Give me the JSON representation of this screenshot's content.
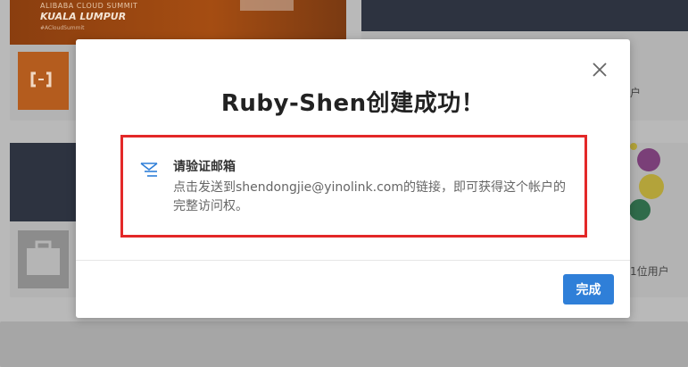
{
  "background": {
    "banner": {
      "line1": "ALIBABA CLOUD SUMMIT",
      "line2": "KUALA LUMPUR",
      "line3": "#ACloudSummit"
    },
    "right_text_top": "户",
    "right_text_bottom": "1位用户"
  },
  "dialog": {
    "title": "Ruby-Shen创建成功！",
    "close_icon": "close-icon",
    "notice": {
      "icon": "mail-send-icon",
      "heading": "请验证邮箱",
      "message": "点击发送到shendongjie@yinolink.com的链接，即可获得这个帐户的完整访问权。"
    },
    "done_label": "完成"
  },
  "colors": {
    "primary": "#2f7fd8",
    "highlight_border": "#e32828"
  }
}
